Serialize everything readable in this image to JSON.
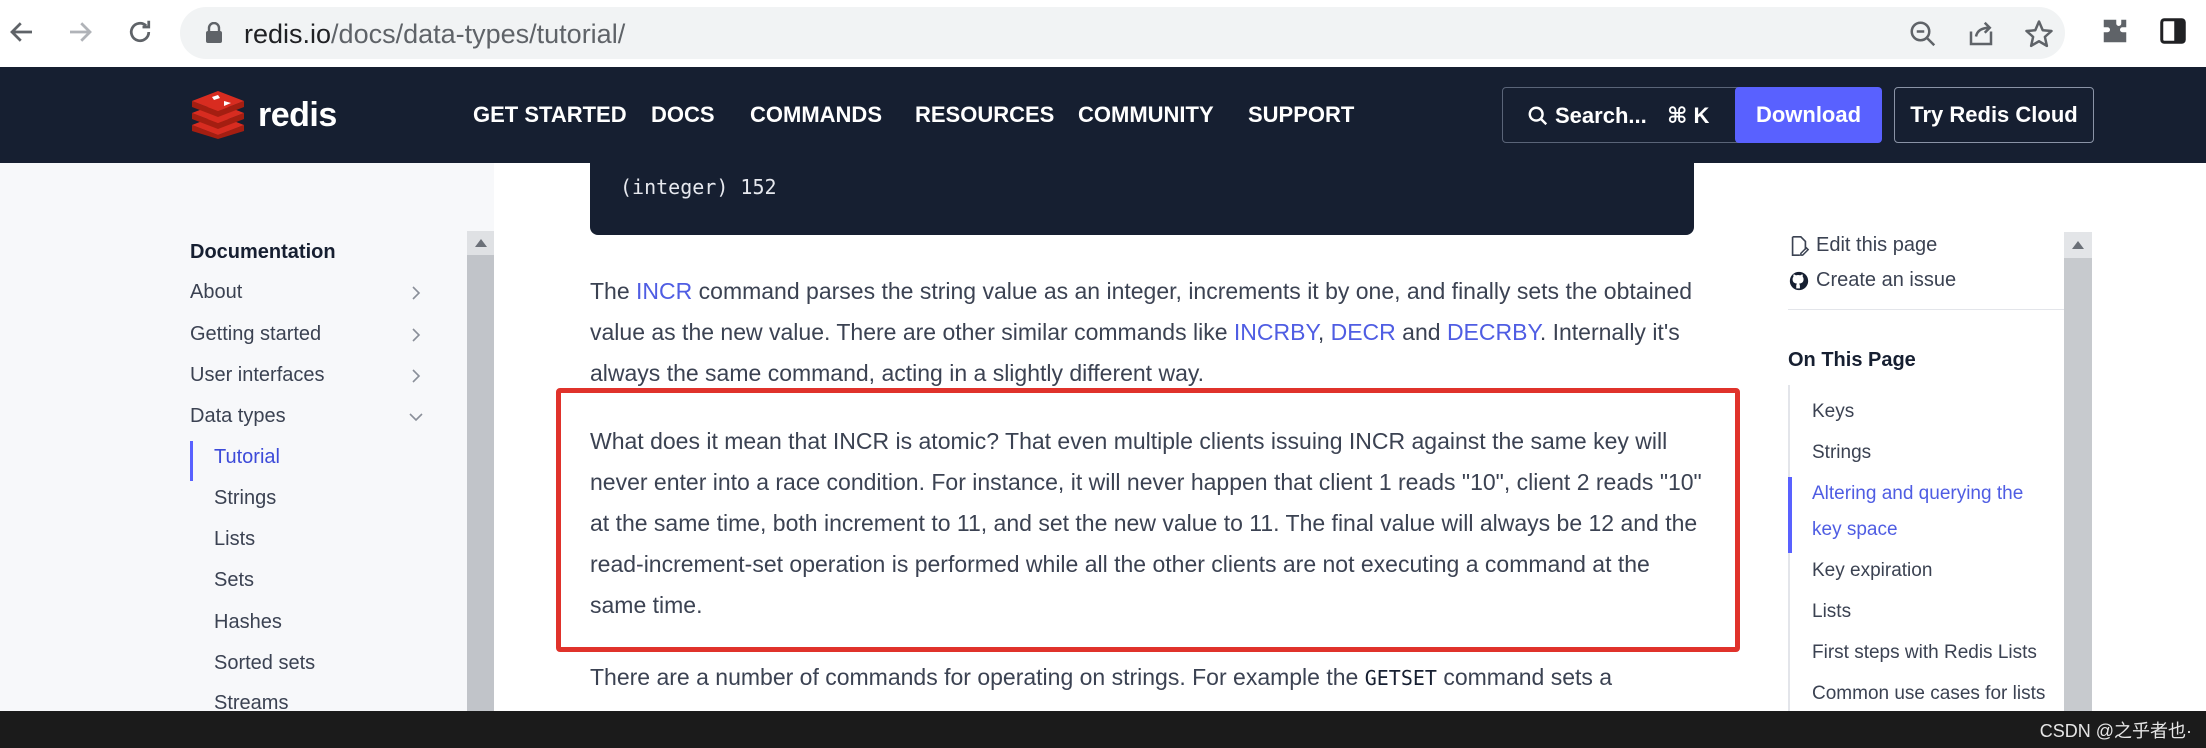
{
  "browser": {
    "url_host": "redis.io",
    "url_path": "/docs/data-types/tutorial/"
  },
  "header": {
    "logo_text": "redis",
    "nav": [
      "GET STARTED",
      "DOCS",
      "COMMANDS",
      "RESOURCES",
      "COMMUNITY",
      "SUPPORT"
    ],
    "search_label": "Search...",
    "search_shortcut": "⌘ K",
    "download_label": "Download",
    "cloud_label": "Try Redis Cloud"
  },
  "left_sidebar": {
    "title": "Documentation",
    "items": [
      "About",
      "Getting started",
      "User interfaces",
      "Data types"
    ],
    "sub_items": [
      "Tutorial",
      "Strings",
      "Lists",
      "Sets",
      "Hashes",
      "Sorted sets",
      "Streams"
    ],
    "active_sub": "Tutorial"
  },
  "main": {
    "code_line": "(integer) 152",
    "p1": {
      "t1": "The ",
      "incr": "INCR",
      "t2": " command parses the string value as an integer, increments it by one, and finally sets the obtained value as the new value. There are other similar commands like ",
      "incrby": "INCRBY",
      "comma": ", ",
      "decr": "DECR",
      "and": " and ",
      "decrby": "DECRBY",
      "t3": ". Internally it's always the same command, acting in a slightly different way."
    },
    "p2": "What does it mean that INCR is atomic? That even multiple clients issuing INCR against the same key will never enter into a race condition. For instance, it will never happen that client 1 reads \"10\", client 2 reads \"10\" at the same time, both increment to 11, and set the new value to 11. The final value will always be 12 and the read-increment-set operation is performed while all the other clients are not executing a command at the same time.",
    "p3": {
      "t1": "There are a number of commands for operating on strings. For example the ",
      "code": "GETSET",
      "t2": " command sets a"
    }
  },
  "right_sidebar": {
    "edit_label": "Edit this page",
    "issue_label": "Create an issue",
    "toc_title": "On This Page",
    "toc": [
      "Keys",
      "Strings",
      "Altering and querying the",
      "key space",
      "Key expiration",
      "Lists",
      "First steps with Redis Lists",
      "Common use cases for lists"
    ]
  },
  "watermark": "CSDN @之乎者也·"
}
